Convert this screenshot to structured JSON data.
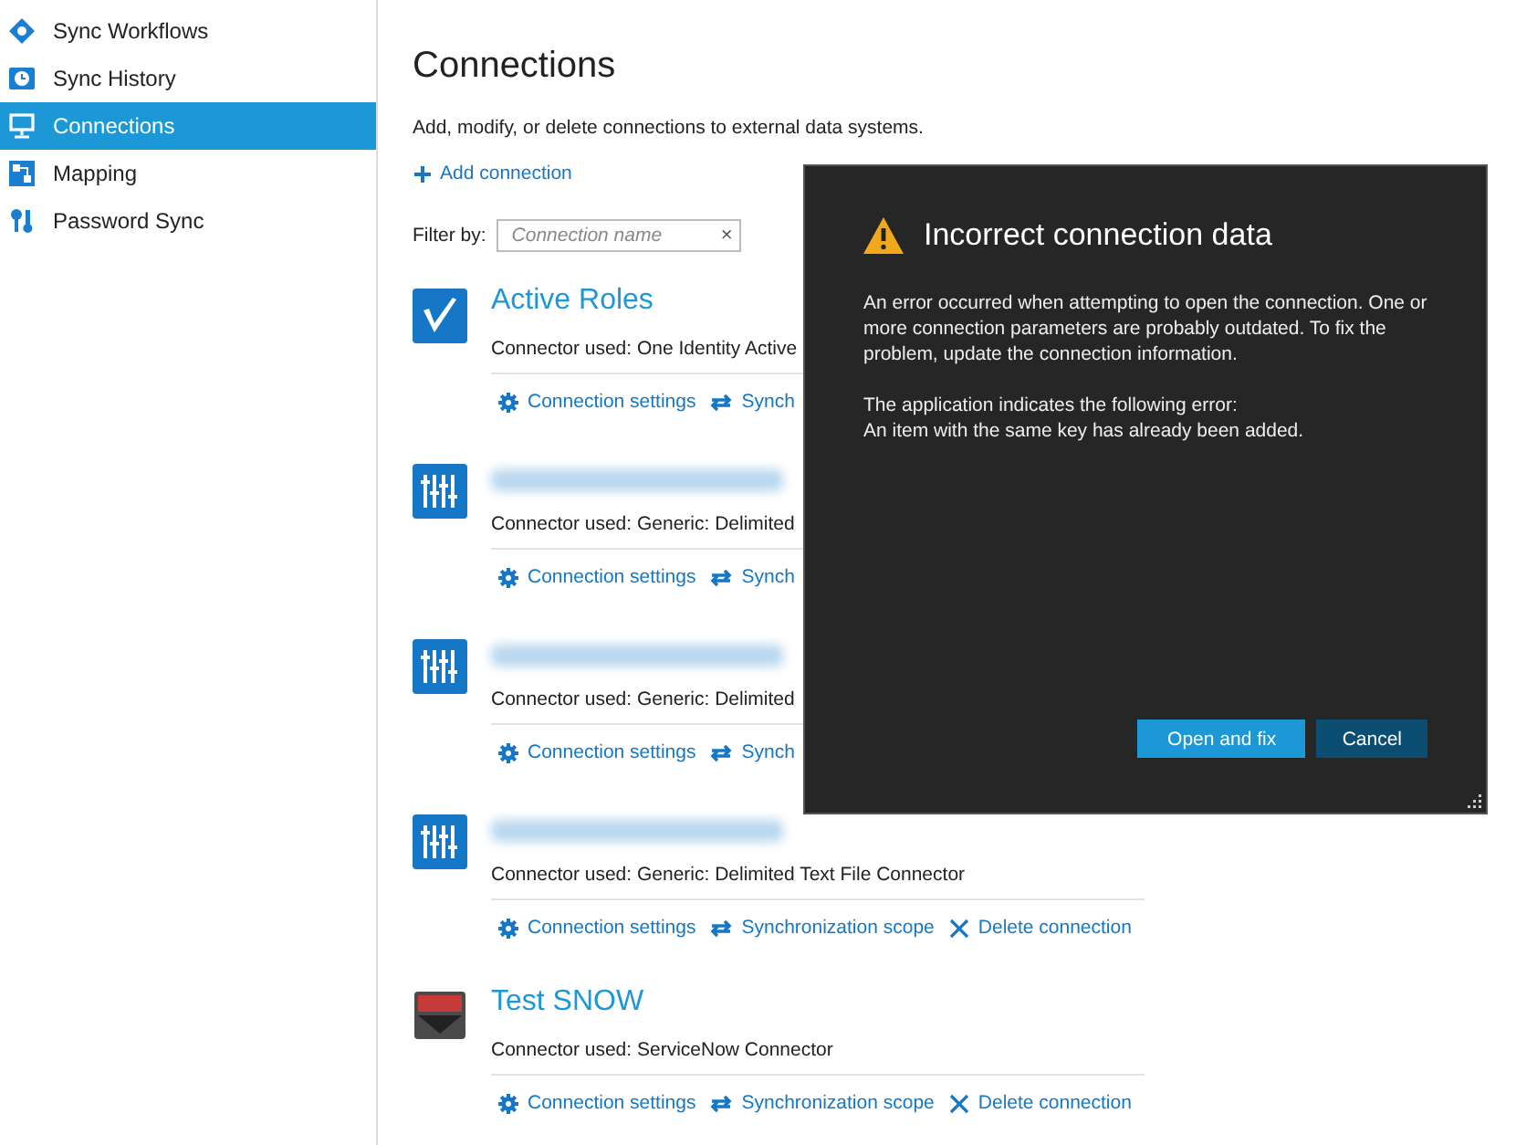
{
  "sidebar": {
    "items": [
      {
        "label": "Sync Workflows",
        "selected": false
      },
      {
        "label": "Sync History",
        "selected": false
      },
      {
        "label": "Connections",
        "selected": true
      },
      {
        "label": "Mapping",
        "selected": false
      },
      {
        "label": "Password Sync",
        "selected": false
      }
    ]
  },
  "page": {
    "title": "Connections",
    "subtitle": "Add, modify, or delete connections to external data systems.",
    "add_link": "Add connection",
    "filter": {
      "label": "Filter by:",
      "placeholder": "Connection name",
      "clear": "×"
    }
  },
  "connections": [
    {
      "kind": "checkmark",
      "name": "Active Roles",
      "name_hidden": false,
      "connector_label": "Connector used:",
      "connector": "One Identity Active",
      "actions": [
        {
          "kind": "settings",
          "label": "Connection settings"
        },
        {
          "kind": "scope",
          "label": "Synch"
        }
      ]
    },
    {
      "kind": "sliders",
      "name_hidden": true,
      "connector_label": "Connector used:",
      "connector": "Generic: Delimited",
      "actions": [
        {
          "kind": "settings",
          "label": "Connection settings"
        },
        {
          "kind": "scope",
          "label": "Synch"
        }
      ]
    },
    {
      "kind": "sliders",
      "name_hidden": true,
      "connector_label": "Connector used:",
      "connector": "Generic: Delimited",
      "actions": [
        {
          "kind": "settings",
          "label": "Connection settings"
        },
        {
          "kind": "scope",
          "label": "Synch"
        }
      ]
    },
    {
      "kind": "sliders",
      "name_hidden": true,
      "connector_label": "Connector used:",
      "connector": "Generic: Delimited Text File Connector",
      "actions": [
        {
          "kind": "settings",
          "label": "Connection settings"
        },
        {
          "kind": "scope",
          "label": "Synchronization scope"
        },
        {
          "kind": "delete",
          "label": "Delete connection"
        }
      ]
    },
    {
      "kind": "monitor",
      "name": "Test SNOW",
      "name_hidden": false,
      "connector_label": "Connector used:",
      "connector": "ServiceNow Connector",
      "actions": [
        {
          "kind": "settings",
          "label": "Connection settings"
        },
        {
          "kind": "scope",
          "label": "Synchronization scope"
        },
        {
          "kind": "delete",
          "label": "Delete connection"
        }
      ]
    }
  ],
  "dialog": {
    "title": "Incorrect connection data",
    "paragraphs": [
      "An error occurred when attempting to open the connection. One or more connection parameters are probably outdated. To fix the problem, update the connection information.",
      "The application indicates the following error:\nAn item with the same key has already been added."
    ],
    "buttons": [
      {
        "kind": "primary",
        "label": "Open and fix"
      },
      {
        "kind": "secondary",
        "label": "Cancel"
      }
    ]
  }
}
